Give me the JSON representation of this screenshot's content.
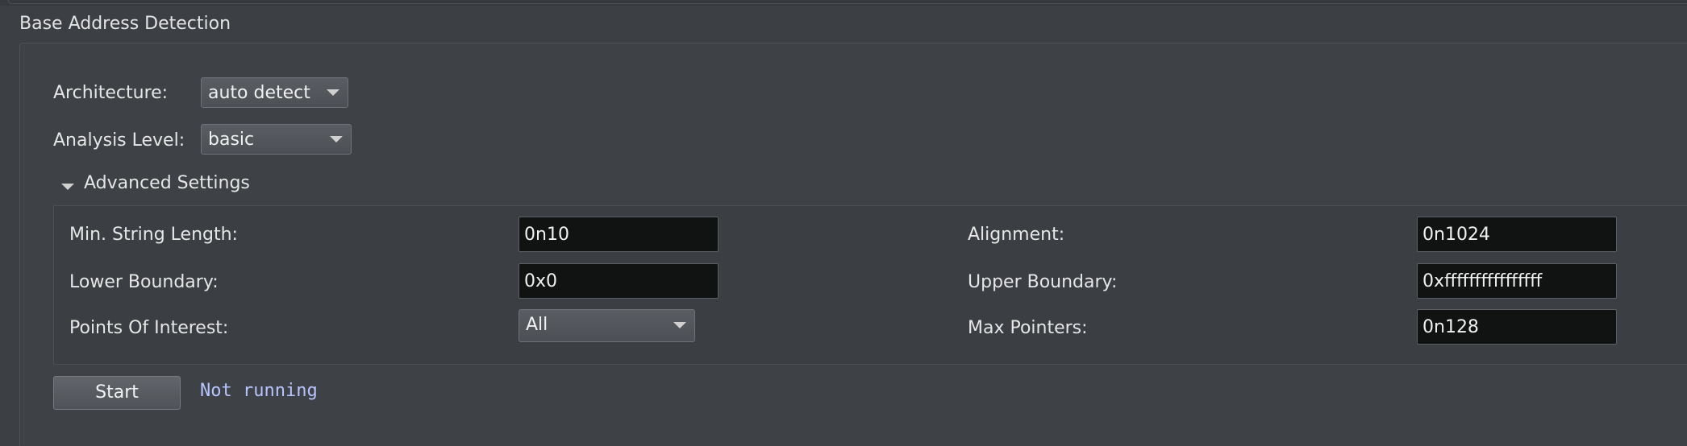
{
  "section": {
    "title": "Base Address Detection"
  },
  "architecture": {
    "label": "Architecture:",
    "value": "auto detect"
  },
  "analysis_level": {
    "label": "Analysis Level:",
    "value": "basic"
  },
  "advanced": {
    "title": "Advanced Settings",
    "min_string_length": {
      "label": "Min. String Length:",
      "value": "0n10"
    },
    "alignment": {
      "label": "Alignment:",
      "value": "0n1024"
    },
    "lower_boundary": {
      "label": "Lower Boundary:",
      "value": "0x0"
    },
    "upper_boundary": {
      "label": "Upper Boundary:",
      "value": "0xffffffffffffffff"
    },
    "points_of_interest": {
      "label": "Points Of Interest:",
      "value": "All"
    },
    "max_pointers": {
      "label": "Max Pointers:",
      "value": "0n128"
    }
  },
  "actions": {
    "start_label": "Start",
    "status": "Not running"
  },
  "colors": {
    "status_text": "#b8c4ff",
    "background": "#3c3f43",
    "field_bg": "#111312"
  }
}
